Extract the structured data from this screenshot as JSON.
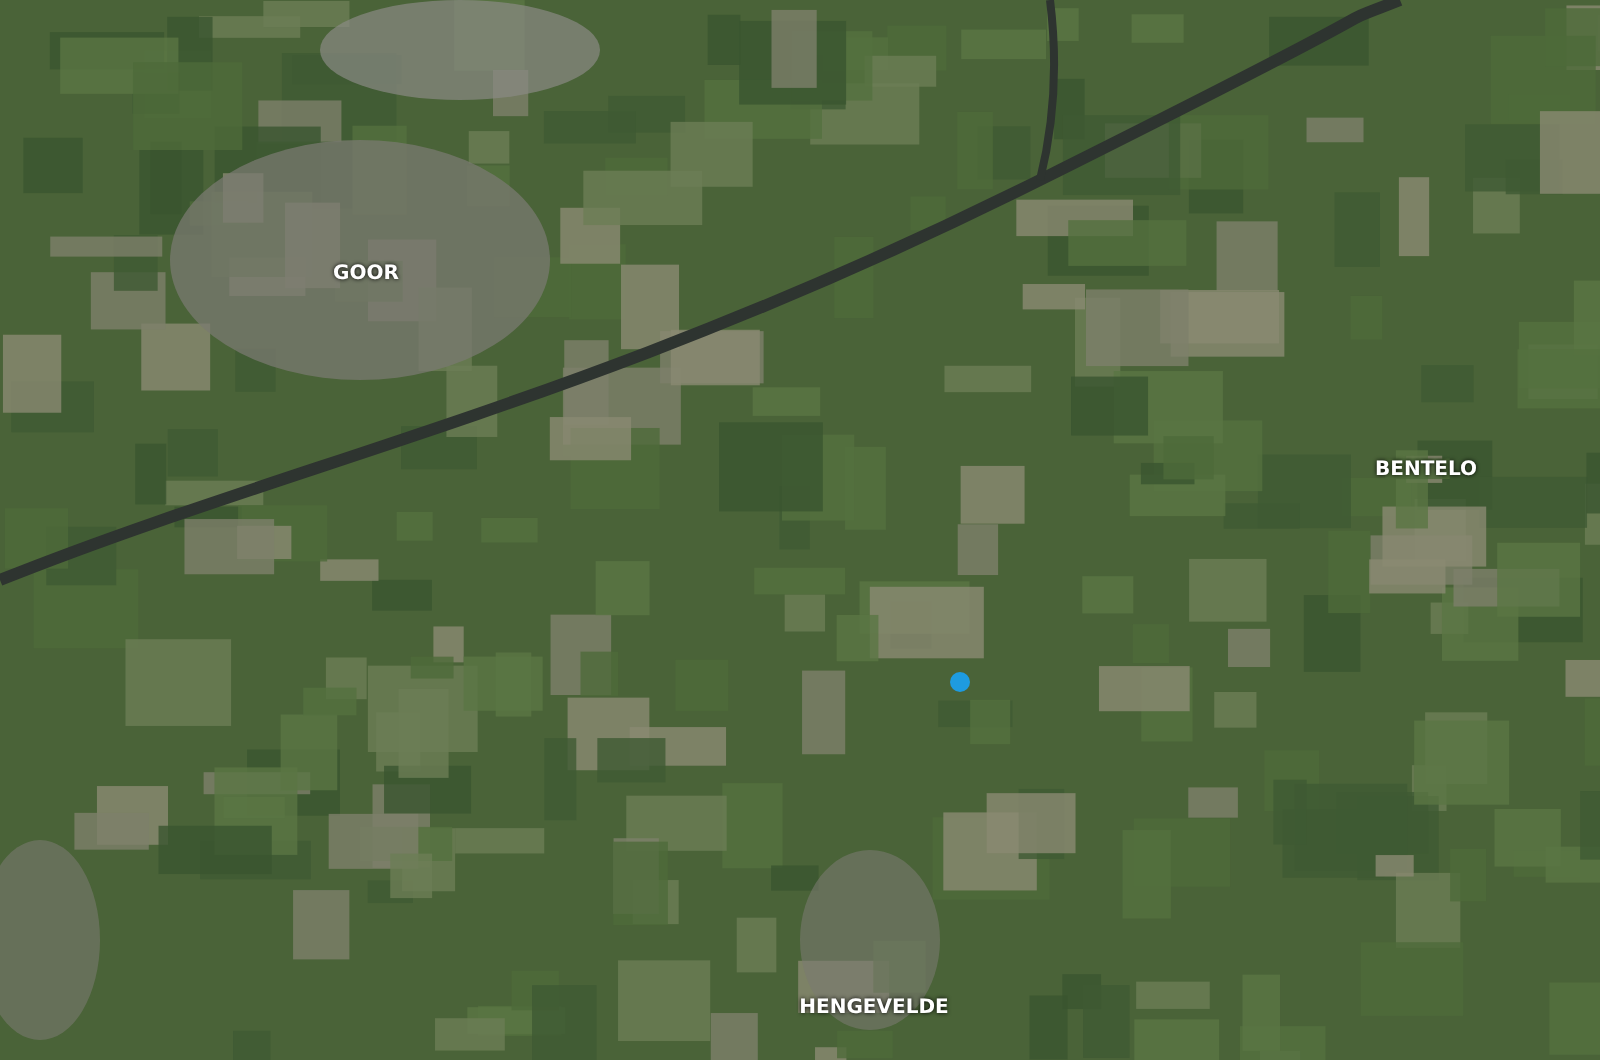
{
  "map": {
    "places": [
      {
        "name": "GOOR"
      },
      {
        "name": "BENTELO"
      },
      {
        "name": "HENGEVELDE"
      }
    ]
  }
}
